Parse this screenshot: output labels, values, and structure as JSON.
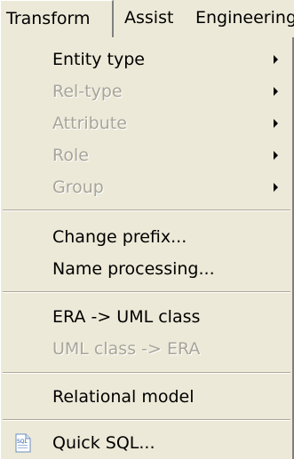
{
  "menubar": {
    "items": [
      "Transform",
      "Assist",
      "Engineering"
    ]
  },
  "menu": {
    "entity_type": "Entity type",
    "rel_type": "Rel-type",
    "attribute": "Attribute",
    "role": "Role",
    "group": "Group",
    "change_prefix": "Change prefix...",
    "name_processing": "Name processing...",
    "era_to_uml": "ERA -> UML class",
    "uml_to_era": "UML class -> ERA",
    "relational_model": "Relational model",
    "quick_sql": "Quick SQL...",
    "quick_sql_icon_text": "SQL"
  }
}
